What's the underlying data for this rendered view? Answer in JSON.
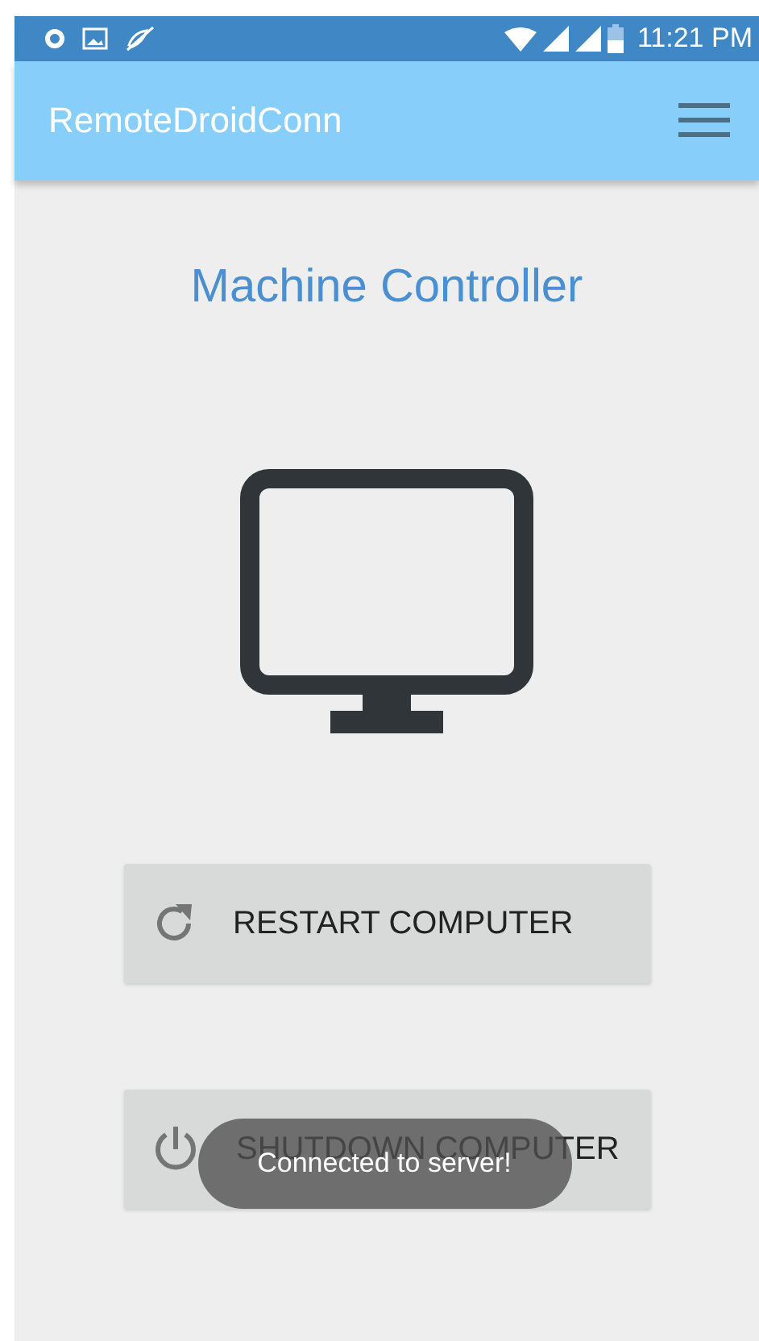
{
  "status_bar": {
    "time": "11:21 PM"
  },
  "app_bar": {
    "title": "RemoteDroidConn"
  },
  "heading": "Machine Controller",
  "buttons": [
    {
      "label": "RESTART COMPUTER",
      "kind": "restart"
    },
    {
      "label": "SHUTDOWN COMPUTER",
      "kind": "shutdown"
    }
  ],
  "toast": {
    "message": "Connected to server!"
  }
}
